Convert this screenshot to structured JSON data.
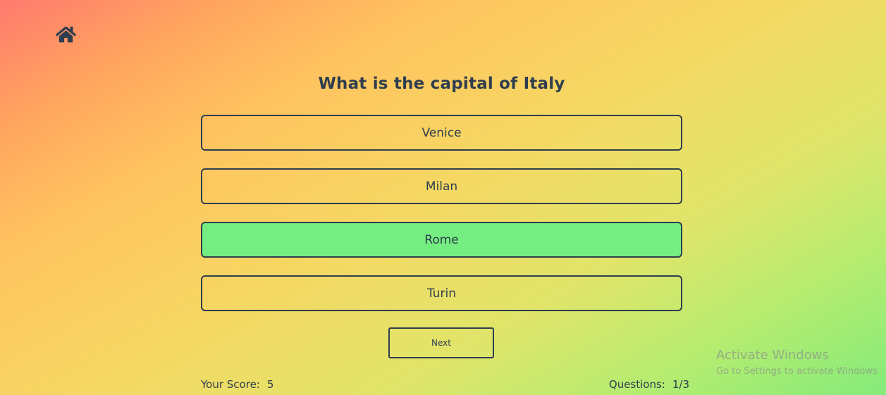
{
  "question": {
    "text": "What is the capital of Italy"
  },
  "answers": [
    {
      "label": "Venice",
      "state": "default"
    },
    {
      "label": "Milan",
      "state": "default"
    },
    {
      "label": "Rome",
      "state": "correct"
    },
    {
      "label": "Turin",
      "state": "default"
    }
  ],
  "next_label": "Next",
  "score": {
    "label": "Your Score:",
    "value": "5"
  },
  "progress": {
    "label": "Questions:",
    "value": "1/3"
  },
  "watermark": {
    "title": "Activate Windows",
    "subtitle": "Go to Settings to activate Windows"
  },
  "colors": {
    "text": "#2f3e4e",
    "correct_answer": "#74ee80"
  },
  "icons": {
    "home": "home-icon"
  }
}
